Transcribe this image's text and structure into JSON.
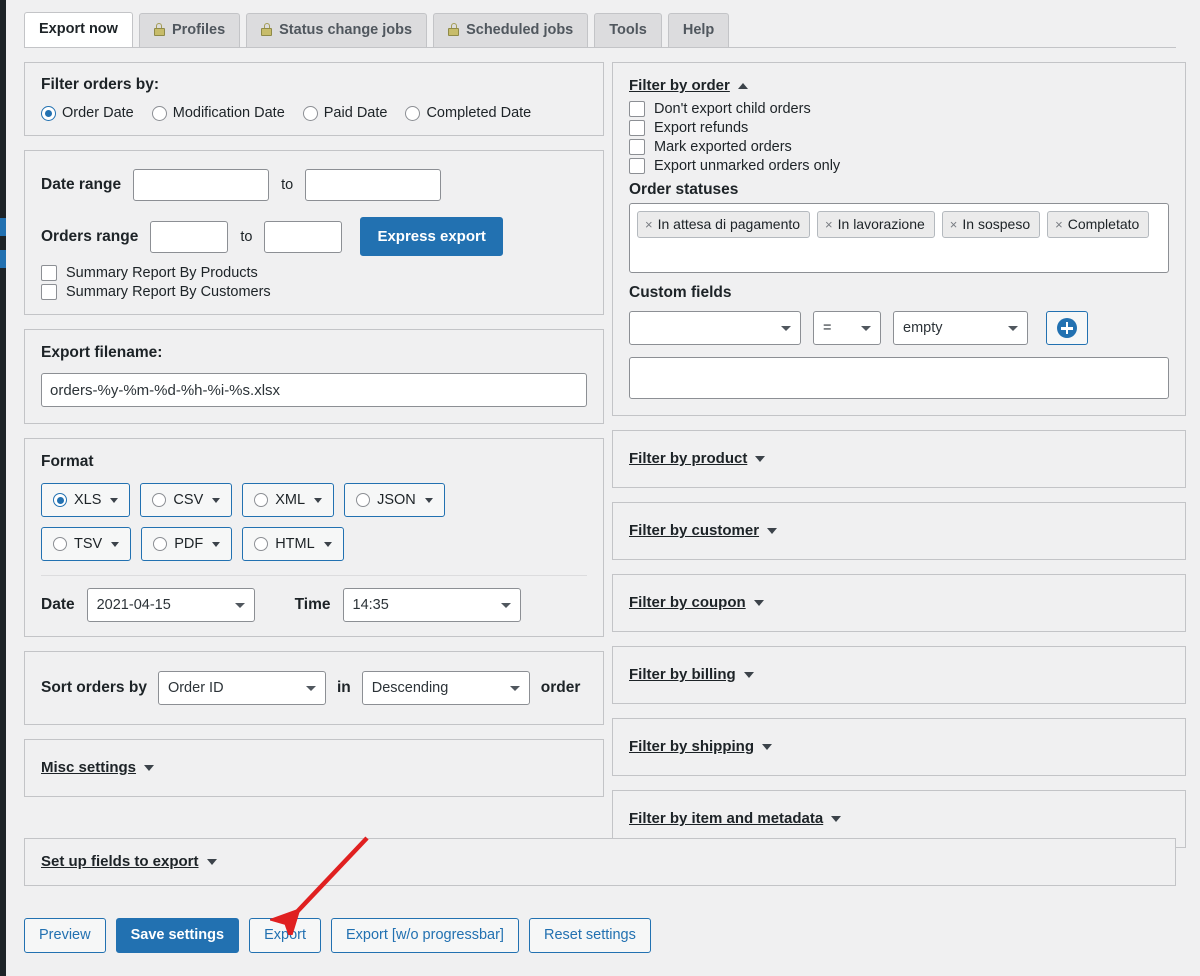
{
  "tabs": [
    {
      "label": "Export now",
      "active": true,
      "locked": false
    },
    {
      "label": "Profiles",
      "active": false,
      "locked": true
    },
    {
      "label": "Status change jobs",
      "active": false,
      "locked": true
    },
    {
      "label": "Scheduled jobs",
      "active": false,
      "locked": true
    },
    {
      "label": "Tools",
      "active": false,
      "locked": false
    },
    {
      "label": "Help",
      "active": false,
      "locked": false
    }
  ],
  "filter_orders_by": {
    "title": "Filter orders by:",
    "options": [
      {
        "label": "Order Date",
        "selected": true
      },
      {
        "label": "Modification Date",
        "selected": false
      },
      {
        "label": "Paid Date",
        "selected": false
      },
      {
        "label": "Completed Date",
        "selected": false
      }
    ]
  },
  "ranges": {
    "date_range_label": "Date range",
    "date_from": "",
    "date_to": "",
    "to_label": "to",
    "orders_range_label": "Orders range",
    "orders_from": "",
    "orders_to": "",
    "express_export_label": "Express export",
    "checkboxes": [
      {
        "label": "Summary Report By Products",
        "checked": false
      },
      {
        "label": "Summary Report By Customers",
        "checked": false
      }
    ]
  },
  "export_filename": {
    "title": "Export filename:",
    "value": "orders-%y-%m-%d-%h-%i-%s.xlsx"
  },
  "format": {
    "title": "Format",
    "options": [
      {
        "label": "XLS",
        "selected": true
      },
      {
        "label": "CSV",
        "selected": false
      },
      {
        "label": "XML",
        "selected": false
      },
      {
        "label": "JSON",
        "selected": false
      },
      {
        "label": "TSV",
        "selected": false
      },
      {
        "label": "PDF",
        "selected": false
      },
      {
        "label": "HTML",
        "selected": false
      }
    ],
    "date_label": "Date",
    "date_value": "2021-04-15",
    "time_label": "Time",
    "time_value": "14:35"
  },
  "sort": {
    "prefix_label": "Sort orders by",
    "field_value": "Order ID",
    "in_label": "in",
    "direction_value": "Descending",
    "suffix_label": "order"
  },
  "misc_settings": {
    "label": "Misc settings"
  },
  "filter_by_order": {
    "label": "Filter by order",
    "expanded": true,
    "checkboxes": [
      {
        "label": "Don't export child orders",
        "checked": false
      },
      {
        "label": "Export refunds",
        "checked": false
      },
      {
        "label": "Mark exported orders",
        "checked": false
      },
      {
        "label": "Export unmarked orders only",
        "checked": false
      }
    ],
    "order_statuses_label": "Order statuses",
    "order_statuses": [
      "In attesa di pagamento",
      "In lavorazione",
      "In sospeso",
      "Completato"
    ],
    "remove_glyph": "×",
    "custom_fields_label": "Custom fields",
    "custom_field_key": "",
    "custom_field_operator": "=",
    "custom_field_value": "empty",
    "custom_field_note": ""
  },
  "collapsed_filters": [
    {
      "label": "Filter by product"
    },
    {
      "label": "Filter by customer"
    },
    {
      "label": "Filter by coupon"
    },
    {
      "label": "Filter by billing"
    },
    {
      "label": "Filter by shipping"
    },
    {
      "label": "Filter by item and metadata"
    }
  ],
  "setup_fields": {
    "label": "Set up fields to export"
  },
  "actions": [
    {
      "label": "Preview",
      "primary": false
    },
    {
      "label": "Save settings",
      "primary": true
    },
    {
      "label": "Export",
      "primary": false
    },
    {
      "label": "Export [w/o progressbar]",
      "primary": false
    },
    {
      "label": "Reset settings",
      "primary": false
    }
  ],
  "annotation": {
    "arrow_color": "#e02020"
  },
  "colors": {
    "accent": "#2271b1",
    "background": "#f0f0f1",
    "border": "#c3c4c7",
    "text": "#1d2327",
    "lock": "#c7bc6a"
  }
}
